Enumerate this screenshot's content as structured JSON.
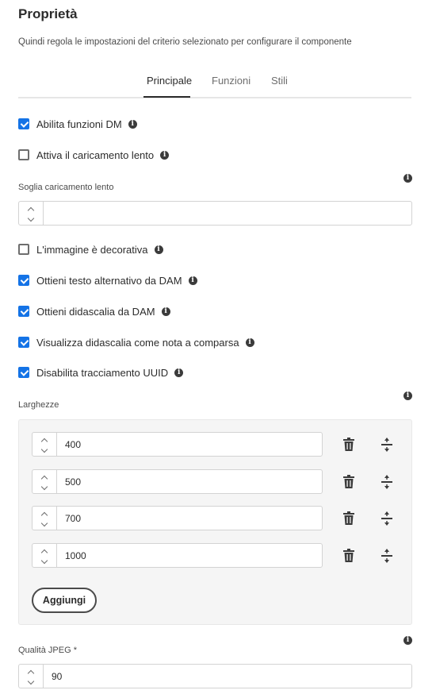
{
  "panel": {
    "title": "Proprietà",
    "subtitle": "Quindi regola le impostazioni del criterio selezionato per configurare il componente"
  },
  "tabs": [
    {
      "label": "Principale",
      "selected": true
    },
    {
      "label": "Funzioni",
      "selected": false
    },
    {
      "label": "Stili",
      "selected": false
    }
  ],
  "checkboxes": {
    "dm": {
      "label": "Abilita funzioni DM",
      "checked": true
    },
    "lazy": {
      "label": "Attiva il caricamento lento",
      "checked": false
    },
    "decorative": {
      "label": "L'immagine è decorativa",
      "checked": false
    },
    "alt": {
      "label": "Ottieni testo alternativo da DAM",
      "checked": true
    },
    "caption": {
      "label": "Ottieni didascalia da DAM",
      "checked": true
    },
    "popup": {
      "label": "Visualizza didascalia come nota a comparsa",
      "checked": true
    },
    "uuid": {
      "label": "Disabilita tracciamento UUID",
      "checked": true
    }
  },
  "lazy_threshold": {
    "label": "Soglia caricamento lento",
    "value": ""
  },
  "widths": {
    "label": "Larghezze",
    "items": [
      "400",
      "500",
      "700",
      "1000"
    ],
    "add_label": "Aggiungi"
  },
  "jpeg_quality": {
    "label": "Qualità JPEG *",
    "value": "90"
  },
  "colors": {
    "accent": "#1473e6",
    "text": "#2c2c2c",
    "panel_bg": "#f5f5f5"
  },
  "icons": [
    "info-icon",
    "chevron-up-icon",
    "chevron-down-icon",
    "trash-icon",
    "reorder-icon"
  ]
}
